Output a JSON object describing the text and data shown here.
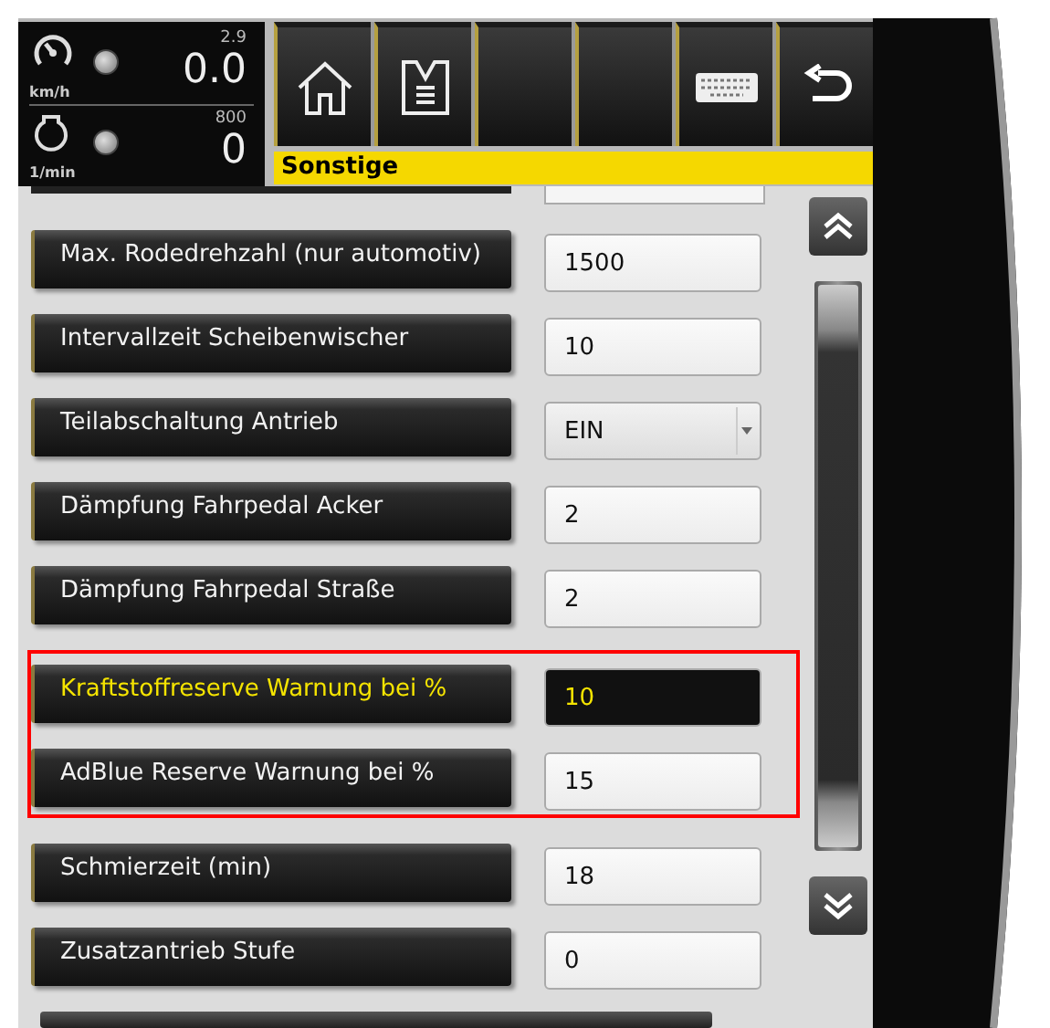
{
  "gauges": [
    {
      "kind": "speed",
      "unit": "km/h",
      "setpoint": "2.9",
      "value": "0.0"
    },
    {
      "kind": "engine",
      "unit": "1/min",
      "setpoint": "800",
      "value": "0"
    }
  ],
  "toolbar": [
    {
      "kind": "home"
    },
    {
      "kind": "menu"
    },
    {
      "kind": "empty"
    },
    {
      "kind": "empty"
    },
    {
      "kind": "keyboard"
    },
    {
      "kind": "back"
    }
  ],
  "title": "Sonstige",
  "rows": [
    {
      "label": "Max. Rodedrehzahl (nur automotiv)",
      "value": "1500",
      "kind": "number",
      "selected": false,
      "highlighted": false
    },
    {
      "label": "Intervallzeit Scheibenwischer",
      "value": "10",
      "kind": "number",
      "selected": false,
      "highlighted": false
    },
    {
      "label": "Teilabschaltung Antrieb",
      "value": "EIN",
      "kind": "dropdown",
      "selected": false,
      "highlighted": false
    },
    {
      "label": "Dämpfung Fahrpedal Acker",
      "value": "2",
      "kind": "number",
      "selected": false,
      "highlighted": false
    },
    {
      "label": "Dämpfung Fahrpedal Straße",
      "value": "2",
      "kind": "number",
      "selected": false,
      "highlighted": false
    },
    {
      "label": "Kraftstoffreserve Warnung bei %",
      "value": "10",
      "kind": "number",
      "selected": true,
      "highlighted": true
    },
    {
      "label": "AdBlue Reserve Warnung bei %",
      "value": "15",
      "kind": "number",
      "selected": false,
      "highlighted": true
    },
    {
      "label": "Schmierzeit (min)",
      "value": "18",
      "kind": "number",
      "selected": false,
      "highlighted": false
    },
    {
      "label": "Zusatzantrieb Stufe",
      "value": "0",
      "kind": "number",
      "selected": false,
      "highlighted": false
    }
  ]
}
